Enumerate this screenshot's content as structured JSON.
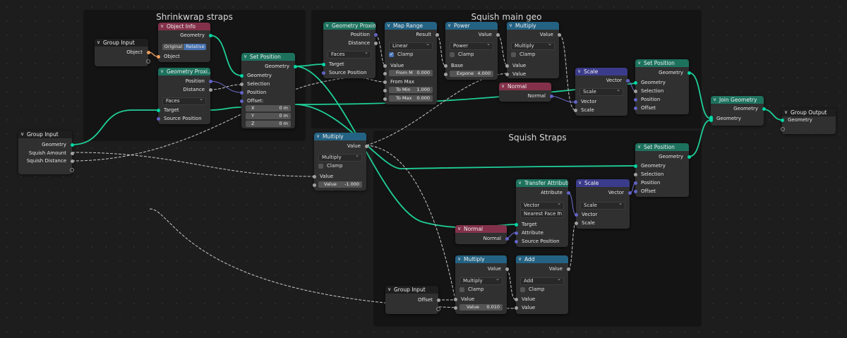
{
  "frames": {
    "shrinkwrap": "Shrinkwrap straps",
    "squish_main": "Squish main geo",
    "squish_straps": "Squish Straps"
  },
  "nodes": {
    "group_input_main": {
      "title": "Group Input",
      "geometry": "Geometry",
      "squish_amount": "Squish Amount",
      "squish_distance": "Squish Distance"
    },
    "group_input_sw": {
      "title": "Group Input",
      "object": "Object"
    },
    "object_info": {
      "title": "Object Info",
      "geometry": "Geometry",
      "original": "Original",
      "relative": "Relative",
      "object": "Object"
    },
    "geo_prox_sw": {
      "title": "Geometry Proxi...",
      "position": "Position",
      "distance": "Distance",
      "mode": "Faces",
      "target": "Target",
      "source_position": "Source Position"
    },
    "set_pos_sw": {
      "title": "Set Position",
      "geometry_out": "Geometry",
      "geometry_in": "Geometry",
      "selection": "Selection",
      "position": "Position",
      "offset": "Offset:",
      "x_label": "X",
      "x_value": "0 m",
      "y_label": "Y",
      "y_value": "0 m",
      "z_label": "Z",
      "z_value": "0 m"
    },
    "multiply_mid": {
      "title": "Multiply",
      "value_out": "Value",
      "mode": "Multiply",
      "clamp": "Clamp",
      "value_in": "Value",
      "field_label": "Value",
      "field_value": "-1.000"
    },
    "geo_prox_main": {
      "title": "Geometry Proxim",
      "position": "Position",
      "distance": "Distance",
      "mode": "Faces",
      "target": "Target",
      "source_position": "Source Position"
    },
    "map_range": {
      "title": "Map Range",
      "result": "Result",
      "mode": "Linear",
      "clamp": "Clamp",
      "value": "Value",
      "from_m_label": "From M",
      "from_m_value": "0.000",
      "from_max": "From Max",
      "to_min_label": "To Min",
      "to_min_value": "1.000",
      "to_max_label": "To Max",
      "to_max_value": "0.000"
    },
    "power": {
      "title": "Power",
      "value_out": "Value",
      "mode": "Power",
      "clamp": "Clamp",
      "base": "Base",
      "expo_label": "Expone",
      "expo_value": "4.000"
    },
    "multiply_top": {
      "title": "Multiply",
      "value_out": "Value",
      "mode": "Multiply",
      "clamp": "Clamp",
      "value_a": "Value",
      "value_b": "Value"
    },
    "normal_top": {
      "title": "Normal",
      "normal": "Normal"
    },
    "scale_top": {
      "title": "Scale",
      "vector_out": "Vector",
      "mode": "Scale",
      "vector_in": "Vector",
      "scale": "Scale"
    },
    "set_pos_top": {
      "title": "Set Position",
      "geometry_out": "Geometry",
      "geometry_in": "Geometry",
      "selection": "Selection",
      "position": "Position",
      "offset": "Offset"
    },
    "join_geometry": {
      "title": "Join Geometry",
      "geometry_out": "Geometry",
      "geometry_in": "Geometry"
    },
    "group_output": {
      "title": "Group Output",
      "geometry": "Geometry"
    },
    "set_pos_bot": {
      "title": "Set Position",
      "geometry_out": "Geometry",
      "geometry_in": "Geometry",
      "selection": "Selection",
      "position": "Position",
      "offset": "Offset"
    },
    "transfer_attr": {
      "title": "Transfer Attribute",
      "attribute_out": "Attribute",
      "type": "Vector",
      "mode": "Nearest Face In",
      "target": "Target",
      "attribute_in": "Attribute",
      "source_position": "Source Position"
    },
    "scale_bot": {
      "title": "Scale",
      "vector_out": "Vector",
      "mode": "Scale",
      "vector_in": "Vector",
      "scale": "Scale"
    },
    "normal_bot": {
      "title": "Normal",
      "normal": "Normal"
    },
    "multiply_bot": {
      "title": "Multiply",
      "value_out": "Value",
      "mode": "Multiply",
      "clamp": "Clamp",
      "value_in": "Value",
      "field_label": "Value",
      "field_value": "0.010"
    },
    "add": {
      "title": "Add",
      "value_out": "Value",
      "mode": "Add",
      "clamp": "Clamp",
      "value_a": "Value",
      "value_b": "Value"
    },
    "group_input_bot": {
      "title": "Group Input",
      "offset": "Offset"
    }
  },
  "colors": {
    "geometry_socket": "#00d6a3",
    "float_socket": "#a1a1a1",
    "vector_socket": "#6363c7",
    "object_socket": "#ed9e5c",
    "geometry_header": "#1d725e",
    "converter_header": "#246283",
    "input_header": "#83314a",
    "vector_header": "#3b3b8c"
  }
}
